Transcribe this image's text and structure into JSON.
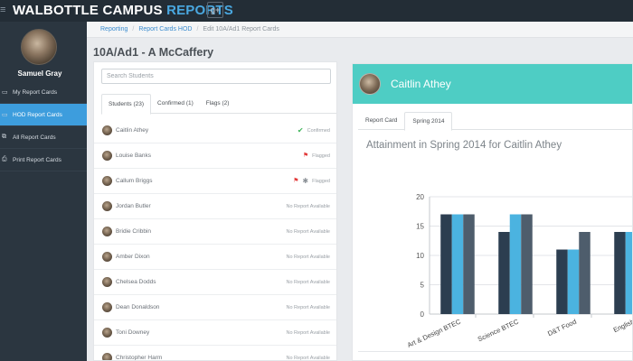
{
  "app": {
    "brand_main": "WALBOTTLE CAMPUS ",
    "brand_accent": "REPORTS",
    "menu_icon": "hamburger-icon",
    "social_icon": "google-plus-icon",
    "social_label": "g+"
  },
  "sidebar": {
    "username": "Samuel Gray",
    "items": [
      {
        "label": "My Report Cards",
        "icon": "file-icon",
        "glyph": "▭",
        "active": false
      },
      {
        "label": "HOD Report Cards",
        "icon": "file-icon",
        "glyph": "▭",
        "active": true
      },
      {
        "label": "All Report Cards",
        "icon": "copy-icon",
        "glyph": "⧉",
        "active": false
      },
      {
        "label": "Print Report Cards",
        "icon": "print-icon",
        "glyph": "⎙",
        "active": false
      }
    ]
  },
  "breadcrumb": {
    "items": [
      "Reporting",
      "Report Cards HOD"
    ],
    "current": "Edit 10A/Ad1 Report Cards"
  },
  "page": {
    "title": "10A/Ad1 - A McCaffery"
  },
  "students": {
    "search_placeholder": "Search Students",
    "tabs": [
      {
        "label": "Students (23)",
        "active": true
      },
      {
        "label": "Confirmed (1)",
        "active": false
      },
      {
        "label": "Flags (2)",
        "active": false
      }
    ],
    "list": [
      {
        "name": "Caitlin Athey",
        "status": "Confirmed",
        "badge": "check"
      },
      {
        "name": "Louise Banks",
        "status": "Flagged",
        "badge": "flag"
      },
      {
        "name": "Callum Briggs",
        "status": "Flagged",
        "badge": "flag-asterisk"
      },
      {
        "name": "Jordan Butler",
        "status": "No Report Available",
        "badge": "none"
      },
      {
        "name": "Bridie Cribbin",
        "status": "No Report Available",
        "badge": "none"
      },
      {
        "name": "Amber Dixon",
        "status": "No Report Available",
        "badge": "none"
      },
      {
        "name": "Chelsea Dodds",
        "status": "No Report Available",
        "badge": "none"
      },
      {
        "name": "Dean Donaldson",
        "status": "No Report Available",
        "badge": "none"
      },
      {
        "name": "Toni Downey",
        "status": "No Report Available",
        "badge": "none"
      },
      {
        "name": "Christopher Harm",
        "status": "No Report Available",
        "badge": "none"
      }
    ]
  },
  "detail": {
    "student_name": "Caitlin Athey",
    "tabs": [
      {
        "label": "Report Card",
        "active": false
      },
      {
        "label": "Spring 2014",
        "active": true
      }
    ]
  },
  "colors": {
    "header_teal": "#4ecdc4",
    "sidebar_active": "#3d9ddd",
    "bar_dark": "#2c3e50",
    "bar_blue": "#4bb3e0",
    "bar_slate": "#4e5d6c"
  },
  "chart_data": {
    "type": "bar",
    "title": "Attainment in Spring 2014 for Caitlin Athey",
    "xlabel": "",
    "ylabel": "",
    "ylim": [
      0,
      20
    ],
    "yticks": [
      0,
      5,
      10,
      15,
      20
    ],
    "grid": true,
    "categories": [
      "Art & Design BTEC",
      "Science BTEC",
      "D&T Food",
      "English"
    ],
    "series": [
      {
        "values": [
          17,
          14,
          11,
          14
        ],
        "color": "#2c3e50"
      },
      {
        "values": [
          17,
          17,
          11,
          14
        ],
        "color": "#4bb3e0"
      },
      {
        "values": [
          17,
          17,
          14,
          14
        ],
        "color": "#4e5d6c"
      }
    ]
  }
}
